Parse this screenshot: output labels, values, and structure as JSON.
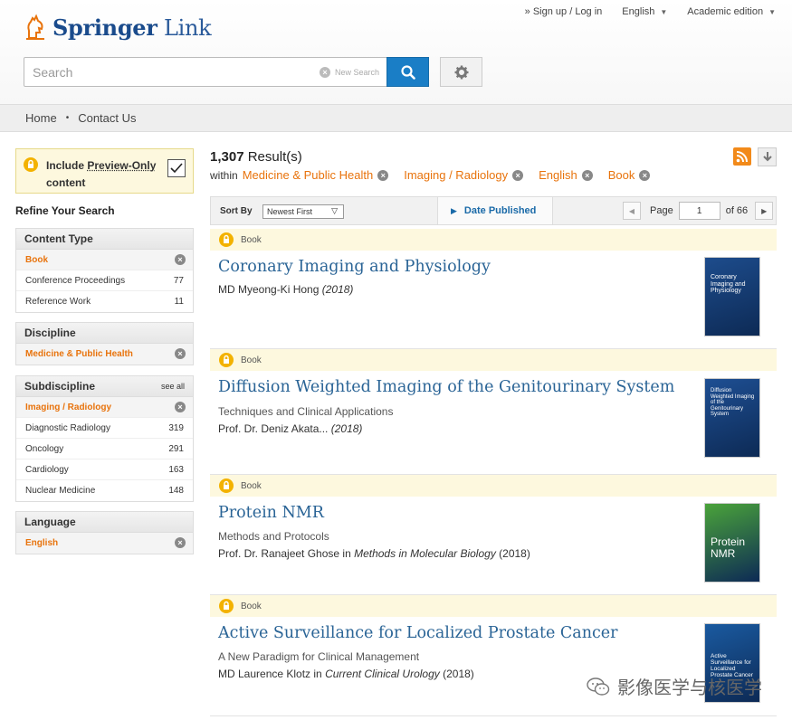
{
  "brand": {
    "name_bold": "Springer",
    "name_light": "Link"
  },
  "top_links": {
    "signin": "» Sign up / Log in",
    "language": "English",
    "edition": "Academic edition"
  },
  "search": {
    "placeholder": "Search",
    "new_search": "New Search"
  },
  "nav": {
    "home": "Home",
    "contact": "Contact Us"
  },
  "preview": {
    "line1": "Include ",
    "underlined": "Preview-Only",
    "line2": "content"
  },
  "refine_title": "Refine Your Search",
  "facets": {
    "content_type": {
      "title": "Content Type",
      "selected": "Book",
      "rows": [
        {
          "label": "Conference Proceedings",
          "count": "77"
        },
        {
          "label": "Reference Work",
          "count": "11"
        }
      ]
    },
    "discipline": {
      "title": "Discipline",
      "selected": "Medicine & Public Health"
    },
    "subdiscipline": {
      "title": "Subdiscipline",
      "see_all": "see all",
      "selected": "Imaging / Radiology",
      "rows": [
        {
          "label": "Diagnostic Radiology",
          "count": "319"
        },
        {
          "label": "Oncology",
          "count": "291"
        },
        {
          "label": "Cardiology",
          "count": "163"
        },
        {
          "label": "Nuclear Medicine",
          "count": "148"
        }
      ]
    },
    "language": {
      "title": "Language",
      "selected": "English"
    }
  },
  "results": {
    "count": "1,307",
    "count_label": " Result(s)",
    "within": "within",
    "filters": [
      "Medicine & Public Health",
      "Imaging / Radiology",
      "English",
      "Book"
    ]
  },
  "sortbar": {
    "sort_by": "Sort By",
    "sort_value": "Newest First",
    "date_published": "Date Published",
    "page_label": "Page",
    "page_value": "1",
    "of_label": "of 66"
  },
  "items": [
    {
      "type": "Book",
      "title": "Coronary Imaging and Physiology",
      "subtitle": "",
      "authors": "MD Myeong-Ki Hong ",
      "series": "",
      "year": "(2018)",
      "cover_text": "Coronary Imaging and Physiology",
      "cover_color": "#1d4c8c"
    },
    {
      "type": "Book",
      "title": "Diffusion Weighted Imaging of the Genitourinary System",
      "subtitle": "Techniques and Clinical Applications",
      "authors": "Prof. Dr. Deniz Akata... ",
      "series": "",
      "year": "(2018)",
      "cover_text": "Diffusion Weighted Imaging of the Genitourinary System",
      "cover_color": "#1e4f93"
    },
    {
      "type": "Book",
      "title": "Protein NMR",
      "subtitle": "Methods and Protocols",
      "authors": "Prof. Dr. Ranajeet Ghose in ",
      "series": "Methods in Molecular Biology",
      "year": " (2018)",
      "cover_text": "Protein NMR",
      "cover_color": "#4aa33a"
    },
    {
      "type": "Book",
      "title": "Active Surveillance for Localized Prostate Cancer",
      "subtitle": "A New Paradigm for Clinical Management",
      "authors": "MD Laurence Klotz in ",
      "series": "Current Clinical Urology",
      "year": " (2018)",
      "cover_text": "Active Surveillance for Localized Prostate Cancer",
      "cover_color": "#1a5aa0"
    }
  ],
  "watermark": "影像医学与核医学"
}
